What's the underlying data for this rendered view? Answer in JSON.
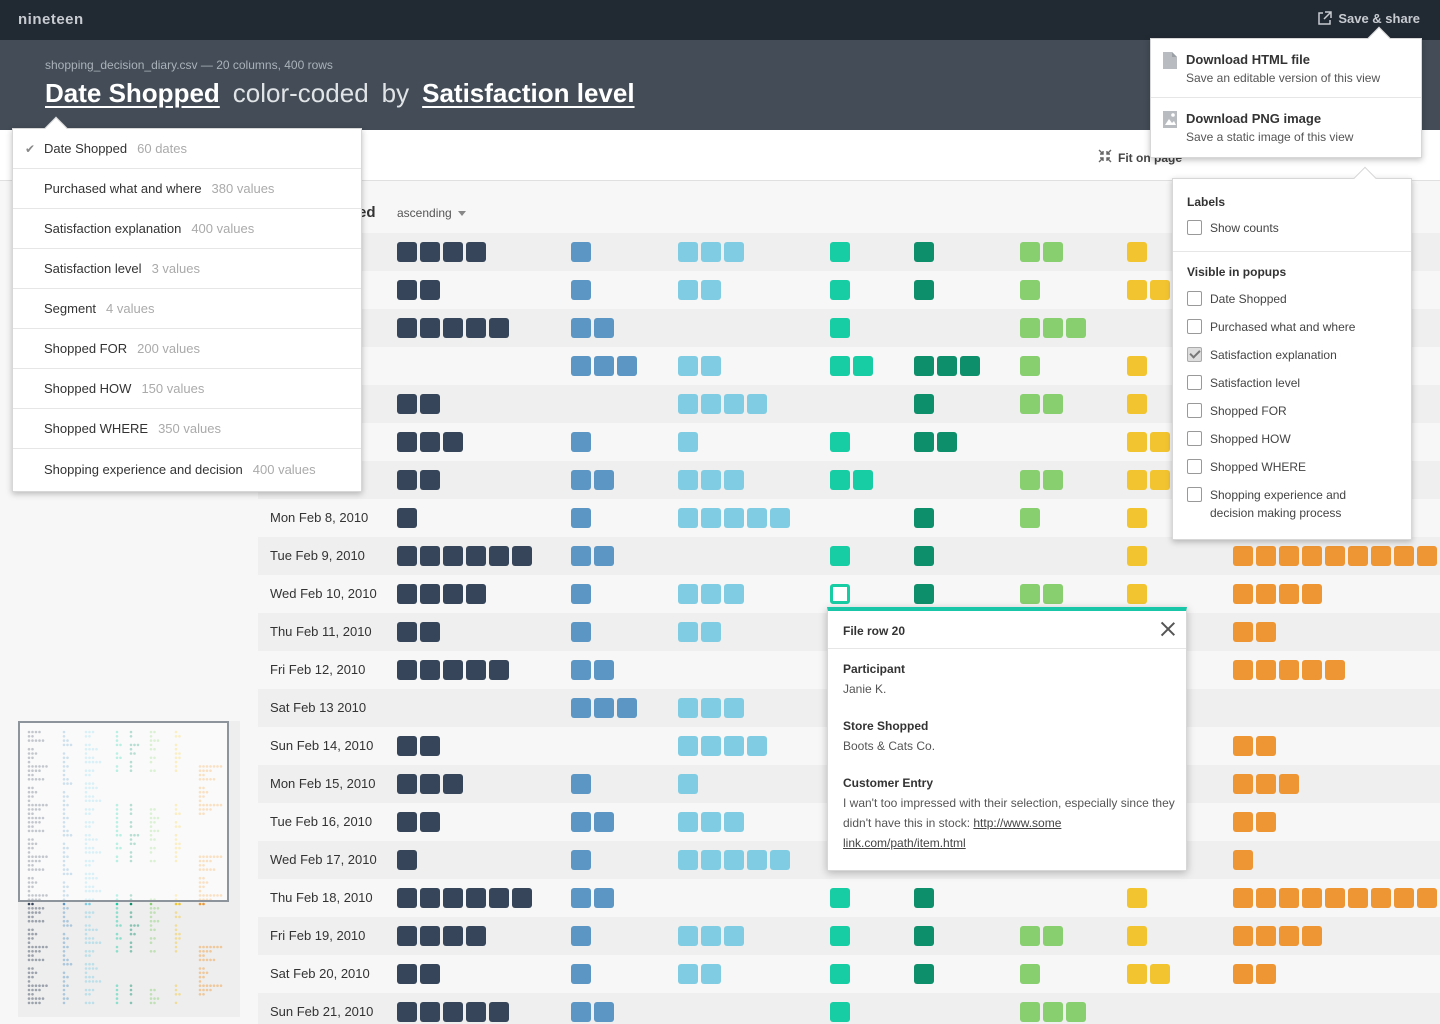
{
  "app": {
    "name": "nineteen",
    "save_share_label": "Save & share"
  },
  "header": {
    "file_info": "shopping_decision_diary.csv — 20 columns, 400 rows",
    "group_field": "Date Shopped",
    "connector1": "color-coded",
    "connector2": "by",
    "color_field": "Satisfaction level"
  },
  "toolbar": {
    "fit_label": "Fit on page"
  },
  "sort": {
    "label": "ed",
    "order": "ascending"
  },
  "colors": {
    "navy": "#364559",
    "steel": "#5b96c4",
    "sky": "#80cde3",
    "teal": "#17cda4",
    "forest": "#0e8f6b",
    "lime": "#88cf6f",
    "gold": "#f2c530",
    "orange": "#ef9634",
    "accent": "#19c6a7"
  },
  "grid": {
    "rows": [
      {
        "date": "",
        "counts": [
          4,
          1,
          3,
          1,
          1,
          2,
          1,
          0
        ]
      },
      {
        "date": "",
        "counts": [
          2,
          1,
          2,
          1,
          1,
          1,
          2,
          0
        ]
      },
      {
        "date": "",
        "counts": [
          5,
          2,
          0,
          1,
          0,
          3,
          0,
          0
        ]
      },
      {
        "date": "",
        "counts": [
          0,
          3,
          2,
          2,
          3,
          1,
          1,
          0
        ]
      },
      {
        "date": "",
        "counts": [
          2,
          0,
          4,
          0,
          1,
          2,
          1,
          0
        ]
      },
      {
        "date": "",
        "counts": [
          3,
          1,
          1,
          1,
          2,
          0,
          2,
          0
        ]
      },
      {
        "date": "",
        "counts": [
          2,
          2,
          3,
          2,
          0,
          2,
          2,
          0
        ]
      },
      {
        "date": "Mon Feb 8, 2010",
        "counts": [
          1,
          1,
          5,
          0,
          1,
          1,
          1,
          0
        ]
      },
      {
        "date": "Tue Feb 9, 2010",
        "counts": [
          6,
          2,
          0,
          1,
          1,
          0,
          1,
          9
        ]
      },
      {
        "date": "Wed Feb 10, 2010",
        "counts": [
          4,
          1,
          3,
          1,
          1,
          2,
          1,
          4
        ]
      },
      {
        "date": "Thu Feb 11, 2010",
        "counts": [
          2,
          1,
          2,
          0,
          0,
          0,
          0,
          2
        ]
      },
      {
        "date": "Fri Feb 12, 2010",
        "counts": [
          5,
          2,
          0,
          0,
          0,
          0,
          0,
          5
        ]
      },
      {
        "date": "Sat Feb 13 2010",
        "counts": [
          0,
          3,
          3,
          0,
          0,
          0,
          0,
          0
        ]
      },
      {
        "date": "Sun Feb 14, 2010",
        "counts": [
          2,
          0,
          4,
          0,
          0,
          0,
          0,
          2
        ]
      },
      {
        "date": "Mon Feb 15, 2010",
        "counts": [
          3,
          1,
          1,
          0,
          0,
          0,
          0,
          3
        ]
      },
      {
        "date": "Tue Feb 16, 2010",
        "counts": [
          2,
          2,
          3,
          0,
          0,
          0,
          0,
          2
        ]
      },
      {
        "date": "Wed Feb 17, 2010",
        "counts": [
          1,
          1,
          5,
          0,
          0,
          0,
          0,
          1
        ]
      },
      {
        "date": "Thu Feb 18, 2010",
        "counts": [
          6,
          2,
          0,
          1,
          1,
          0,
          1,
          9
        ]
      },
      {
        "date": "Fri Feb 19, 2010",
        "counts": [
          4,
          1,
          3,
          1,
          1,
          2,
          1,
          4
        ]
      },
      {
        "date": "Sat Feb 20, 2010",
        "counts": [
          2,
          1,
          2,
          1,
          1,
          1,
          2,
          2
        ]
      },
      {
        "date": "Sun Feb 21, 2010",
        "counts": [
          5,
          2,
          0,
          1,
          0,
          3,
          0,
          0
        ]
      }
    ]
  },
  "field_menu": {
    "items": [
      {
        "label": "Date Shopped",
        "count": "60 dates",
        "checked": true
      },
      {
        "label": "Purchased what and where",
        "count": "380 values"
      },
      {
        "label": "Satisfaction explanation",
        "count": "400 values"
      },
      {
        "label": "Satisfaction level",
        "count": "3 values"
      },
      {
        "label": "Segment",
        "count": "4 values"
      },
      {
        "label": "Shopped FOR",
        "count": "200 values"
      },
      {
        "label": "Shopped HOW",
        "count": "150 values"
      },
      {
        "label": "Shopped WHERE",
        "count": "350 values"
      },
      {
        "label": "Shopping experience and decision",
        "count": "400 values"
      }
    ]
  },
  "share_menu": {
    "items": [
      {
        "title": "Download HTML file",
        "subtitle": "Save an editable version of this view",
        "icon": "file-icon"
      },
      {
        "title": "Download PNG image",
        "subtitle": "Save a static image of this view",
        "icon": "image-icon"
      }
    ]
  },
  "labels_popover": {
    "labels_title": "Labels",
    "show_counts": "Show counts",
    "visible_title": "Visible in popups",
    "fields": [
      {
        "label": "Date Shopped",
        "checked": false
      },
      {
        "label": "Purchased what and where",
        "checked": false
      },
      {
        "label": "Satisfaction explanation",
        "checked": true
      },
      {
        "label": "Satisfaction level",
        "checked": false
      },
      {
        "label": "Shopped FOR",
        "checked": false
      },
      {
        "label": "Shopped HOW",
        "checked": false
      },
      {
        "label": "Shopped WHERE",
        "checked": false
      },
      {
        "label": "Shopping experience and",
        "label2": "decision making process",
        "checked": false
      }
    ]
  },
  "record_popup": {
    "title": "File row 20",
    "participant_label": "Participant",
    "participant_value": "Janie K.",
    "store_label": "Store Shopped",
    "store_value": "Boots & Cats Co.",
    "entry_label": "Customer Entry",
    "entry_text": "I wan't too impressed with their selection, especially since they didn't have this in stock: ",
    "entry_link_1": "http://www.some",
    "entry_link_2": "link.com/path/item.html"
  }
}
